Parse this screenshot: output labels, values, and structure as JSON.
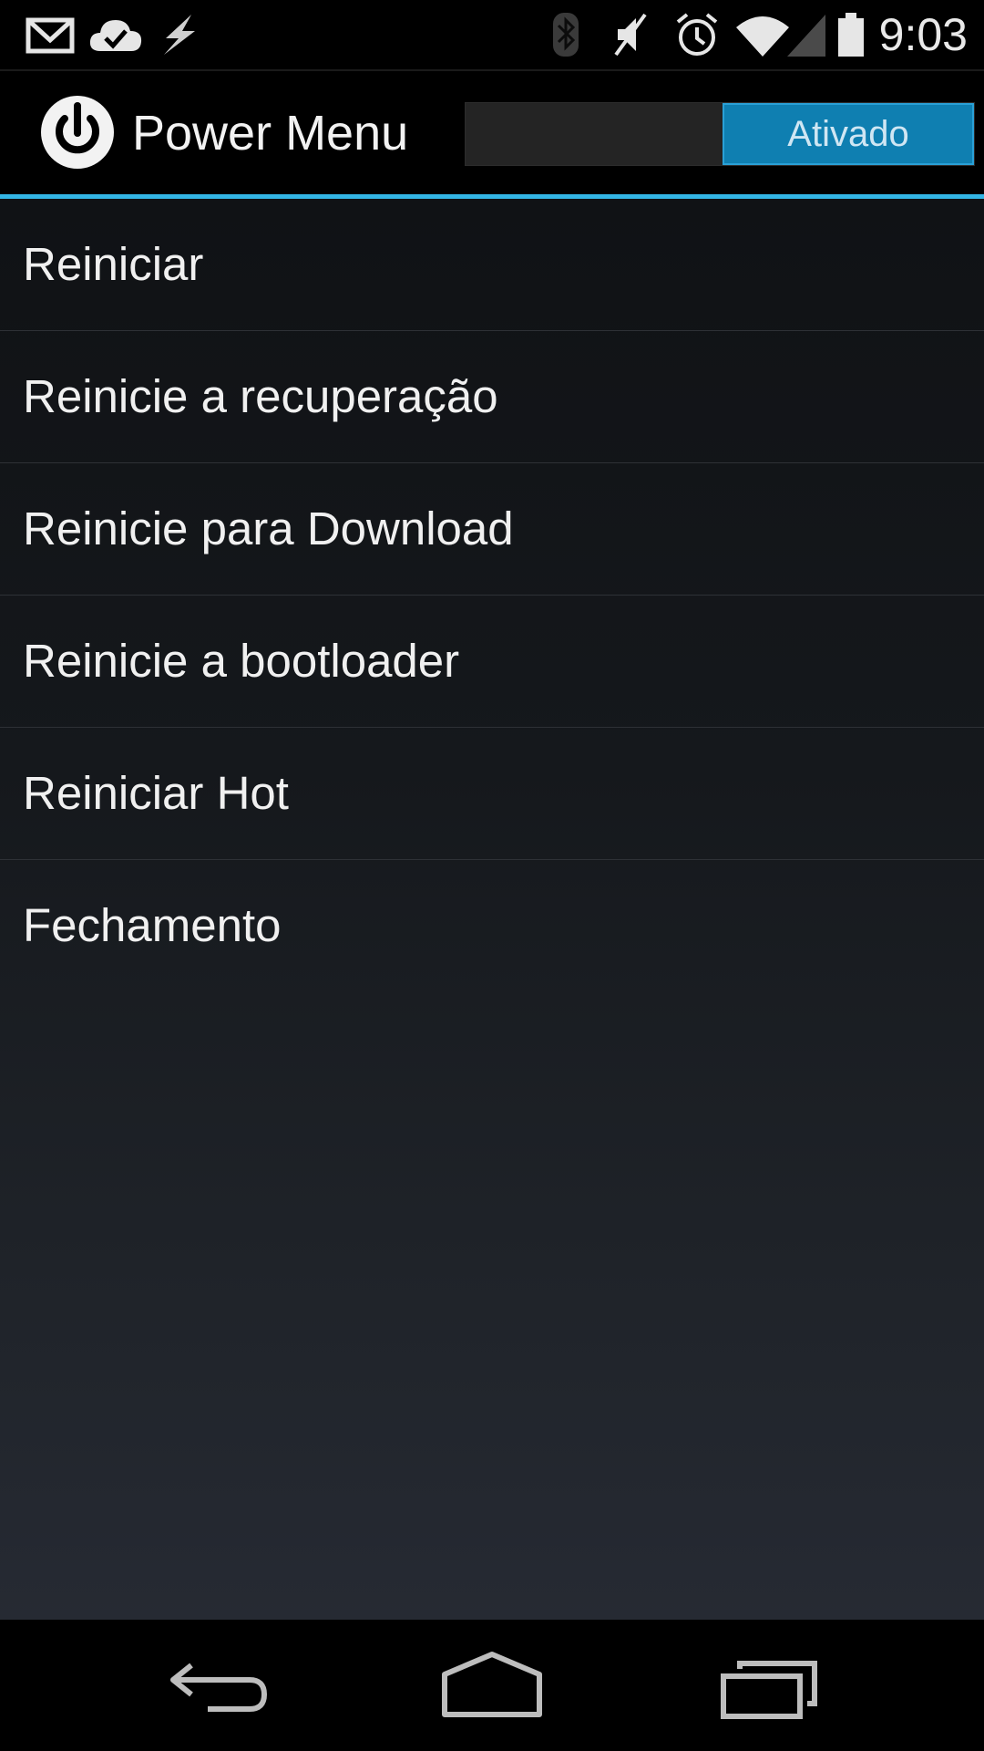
{
  "status_bar": {
    "time": "9:03",
    "left_icons": [
      "gmail-icon",
      "cloud-check-icon",
      "lightning-icon"
    ],
    "right_icons": [
      "bluetooth-icon",
      "mute-icon",
      "alarm-icon",
      "wifi-icon",
      "signal-icon",
      "battery-icon"
    ]
  },
  "action_bar": {
    "title": "Power Menu",
    "icon": "power-icon",
    "switch_label": "Ativado",
    "switch_on": true
  },
  "menu": {
    "items": [
      {
        "label": "Reiniciar"
      },
      {
        "label": "Reinicie a recuperação"
      },
      {
        "label": "Reinicie para Download"
      },
      {
        "label": "Reinicie a bootloader"
      },
      {
        "label": "Reiniciar Hot"
      },
      {
        "label": "Fechamento"
      }
    ]
  },
  "nav_bar": {
    "buttons": [
      "back-icon",
      "home-icon",
      "recents-icon"
    ]
  },
  "colors": {
    "accent": "#33b5e5",
    "switch_on": "#0f7fb1"
  }
}
